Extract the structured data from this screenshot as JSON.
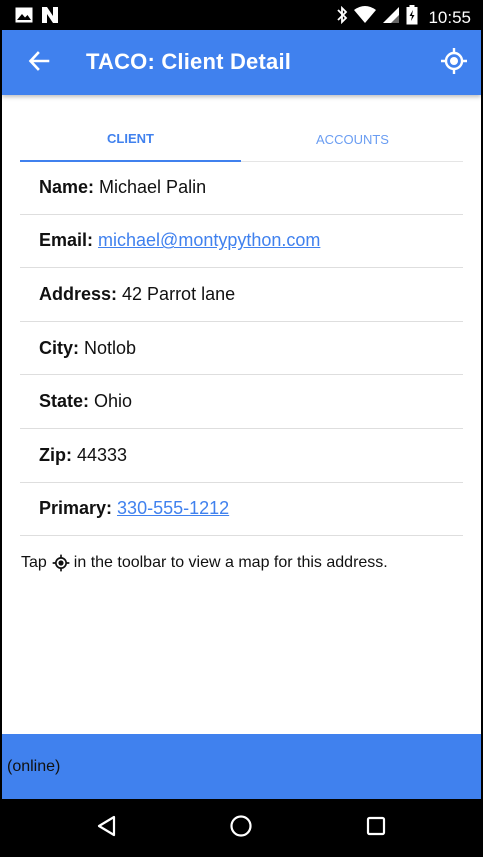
{
  "status_bar": {
    "time": "10:55",
    "left_icons": [
      "image-icon",
      "n-icon"
    ],
    "right_icons": [
      "bluetooth-icon",
      "wifi-icon",
      "signal-icon",
      "battery-icon"
    ]
  },
  "toolbar": {
    "title": "TACO: Client Detail",
    "back_icon": "arrow-left-icon",
    "action_icon": "gps-fixed-icon"
  },
  "tabs": [
    {
      "label": "CLIENT",
      "active": true
    },
    {
      "label": "ACCOUNTS",
      "active": false
    }
  ],
  "details": {
    "name": {
      "label": "Name:",
      "value": "Michael Palin"
    },
    "email": {
      "label": "Email:",
      "value": "michael@montypython.com"
    },
    "address": {
      "label": "Address:",
      "value": "42 Parrot lane"
    },
    "city": {
      "label": "City:",
      "value": "Notlob"
    },
    "state": {
      "label": "State:",
      "value": "Ohio"
    },
    "zip": {
      "label": "Zip:",
      "value": "44333"
    },
    "primary": {
      "label": "Primary:",
      "value": "330-555-1212"
    }
  },
  "hint": {
    "before": "Tap",
    "after": "in the toolbar to view a map for this address."
  },
  "footer": {
    "status": "(online)"
  },
  "colors": {
    "accent": "#4081ee",
    "link": "#4081ee"
  },
  "nav_bar": {
    "icons": [
      "back-triangle-icon",
      "home-circle-icon",
      "recents-square-icon"
    ]
  }
}
